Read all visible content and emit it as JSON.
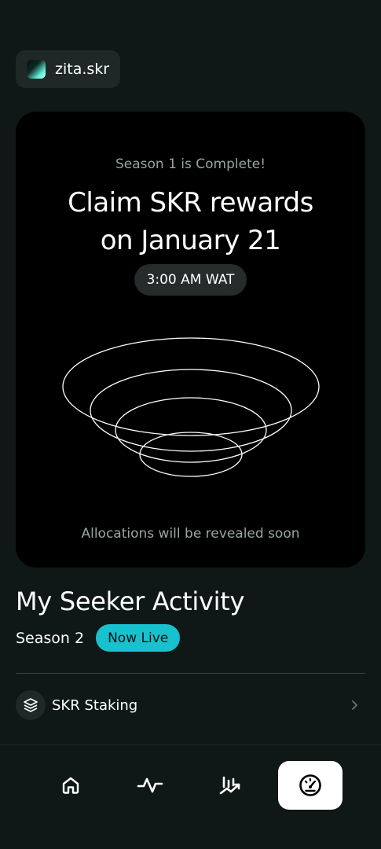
{
  "account": {
    "name": "zita.skr",
    "avatar_icon": "gradient-avatar-icon"
  },
  "season_card": {
    "eyebrow": "Season 1 is Complete!",
    "headline_line1": "Claim SKR rewards",
    "headline_line2": "on January 21",
    "time_label": "3:00 AM WAT",
    "graphic": "concentric-rings-icon",
    "footnote": "Allocations will be revealed soon"
  },
  "activity": {
    "title": "My Seeker Activity",
    "season_label": "Season 2",
    "status_badge": "Now Live",
    "badge_color": "#17c1cd"
  },
  "list_items": [
    {
      "label": "SKR Staking",
      "icon": "layers-icon",
      "trailing_icon": "chevron-right-icon"
    }
  ],
  "bottom_nav": {
    "items": [
      {
        "icon": "home-icon",
        "active": false
      },
      {
        "icon": "activity-icon",
        "active": false
      },
      {
        "icon": "trending-chart-icon",
        "active": false
      },
      {
        "icon": "gauge-icon",
        "active": true
      }
    ]
  },
  "colors": {
    "background": "#101817",
    "card": "#000000",
    "accent": "#17c1cd",
    "muted_text": "#97a6a2"
  }
}
